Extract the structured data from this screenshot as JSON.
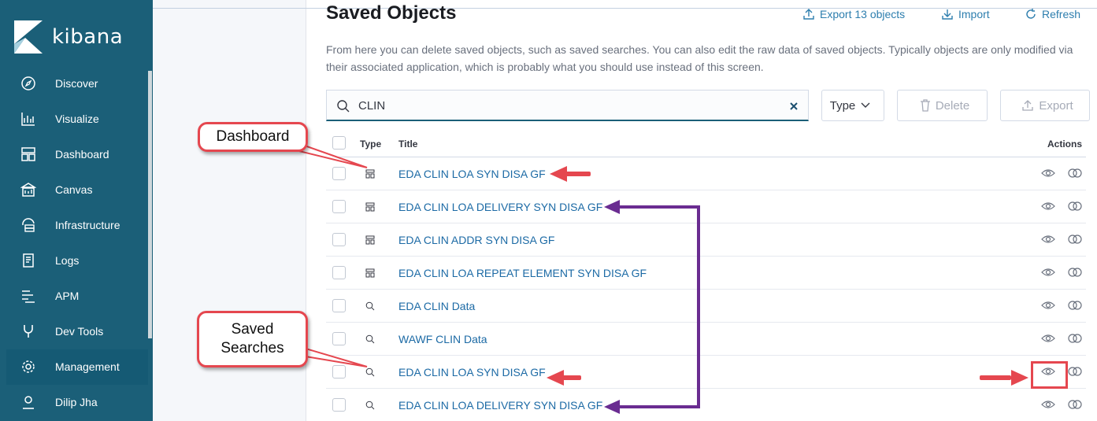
{
  "app": {
    "logo_text": "kibana"
  },
  "sidebar": {
    "items": [
      {
        "label": "Discover",
        "icon": "compass-icon"
      },
      {
        "label": "Visualize",
        "icon": "chart-icon"
      },
      {
        "label": "Dashboard",
        "icon": "dashboard-icon"
      },
      {
        "label": "Canvas",
        "icon": "canvas-icon"
      },
      {
        "label": "Infrastructure",
        "icon": "infrastructure-icon"
      },
      {
        "label": "Logs",
        "icon": "logs-icon"
      },
      {
        "label": "APM",
        "icon": "apm-icon"
      },
      {
        "label": "Dev Tools",
        "icon": "wrench-icon"
      },
      {
        "label": "Management",
        "icon": "gear-icon",
        "active": true
      },
      {
        "label": "Dilip Jha",
        "icon": "user-icon"
      }
    ]
  },
  "page": {
    "title": "Saved Objects",
    "export_all_label": "Export 13 objects",
    "import_label": "Import",
    "refresh_label": "Refresh",
    "description": "From here you can delete saved objects, such as saved searches. You can also edit the raw data of saved objects. Typically objects are only modified via their associated application, which is probably what you should use instead of this screen."
  },
  "toolbar": {
    "search_value": "CLIN",
    "type_label": "Type",
    "delete_label": "Delete",
    "export_label": "Export"
  },
  "table": {
    "headers": {
      "type": "Type",
      "title": "Title",
      "actions": "Actions"
    },
    "rows": [
      {
        "type": "dashboard",
        "title": "EDA CLIN LOA SYN DISA GF"
      },
      {
        "type": "dashboard",
        "title": "EDA CLIN LOA DELIVERY SYN DISA GF"
      },
      {
        "type": "dashboard",
        "title": "EDA CLIN ADDR SYN DISA GF"
      },
      {
        "type": "dashboard",
        "title": "EDA CLIN LOA REPEAT ELEMENT SYN DISA GF"
      },
      {
        "type": "search",
        "title": "EDA CLIN Data"
      },
      {
        "type": "search",
        "title": "WAWF CLIN Data"
      },
      {
        "type": "search",
        "title": "EDA CLIN LOA SYN DISA GF"
      },
      {
        "type": "search",
        "title": "EDA CLIN LOA DELIVERY SYN DISA GF"
      }
    ]
  },
  "annotations": {
    "dashboard_label": "Dashboard",
    "saved_searches_line1": "Saved",
    "saved_searches_line2": "Searches"
  },
  "colors": {
    "sidebar": "#1b5f78",
    "link": "#1c6aa5",
    "annotation_red": "#e5474f",
    "annotation_purple": "#6a2c91"
  }
}
